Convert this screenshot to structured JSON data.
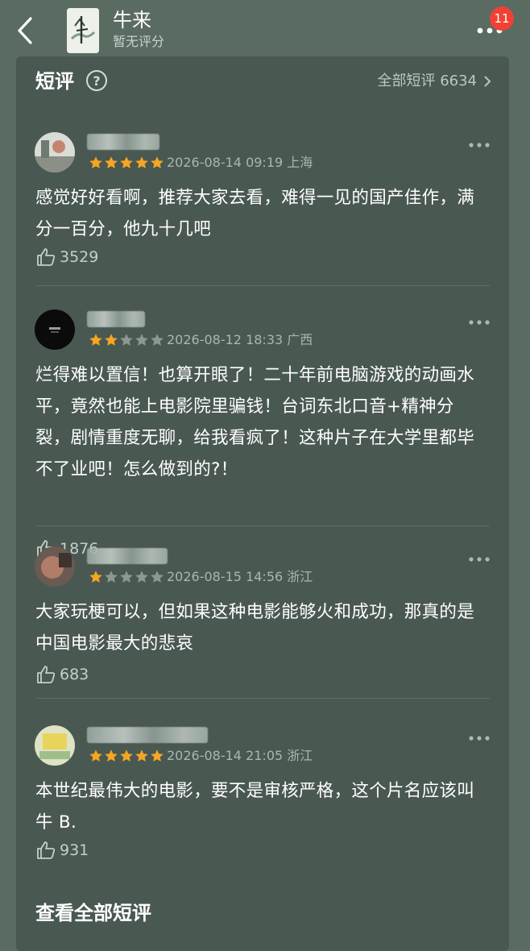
{
  "header": {
    "title": "牛来",
    "subtitle": "暂无评分",
    "badge_count": "11"
  },
  "section": {
    "title": "短评",
    "all_link": "全部短评 6634",
    "footer_link": "查看全部短评"
  },
  "comments": [
    {
      "rating": 5,
      "date": "2026-08-14 09:19",
      "location": "上海",
      "text": "感觉好好看啊，推荐大家去看，难得一见的国产佳作，满分一百分，他九十几吧",
      "likes": "3529"
    },
    {
      "rating": 2,
      "date": "2026-08-12 18:33",
      "location": "广西",
      "text": "烂得难以置信！也算开眼了！二十年前电脑游戏的动画水平，竟然也能上电影院里骗钱！台词东北口音+精神分裂，剧情重度无聊，给我看疯了！这种片子在大学里都毕不了业吧！怎么做到的?！",
      "likes": "1876"
    },
    {
      "rating": 1,
      "date": "2026-08-15 14:56",
      "location": "浙江",
      "text": "大家玩梗可以，但如果这种电影能够火和成功，那真的是中国电影最大的悲哀",
      "likes": "683"
    },
    {
      "rating": 5,
      "date": "2026-08-14 21:05",
      "location": "浙江",
      "text": "本世纪最伟大的电影，要不是审核严格，这个片名应该叫牛 B.",
      "likes": "931"
    }
  ],
  "colors": {
    "page_bg": "#5a6b62",
    "card_bg": "#4a5852",
    "star_on": "#f5a623",
    "star_off": "#8e9893",
    "badge": "#f04134"
  },
  "icons": [
    "back-arrow-icon",
    "more-icon",
    "help-icon",
    "chevron-right-icon",
    "star-icon",
    "thumbs-up-icon"
  ]
}
